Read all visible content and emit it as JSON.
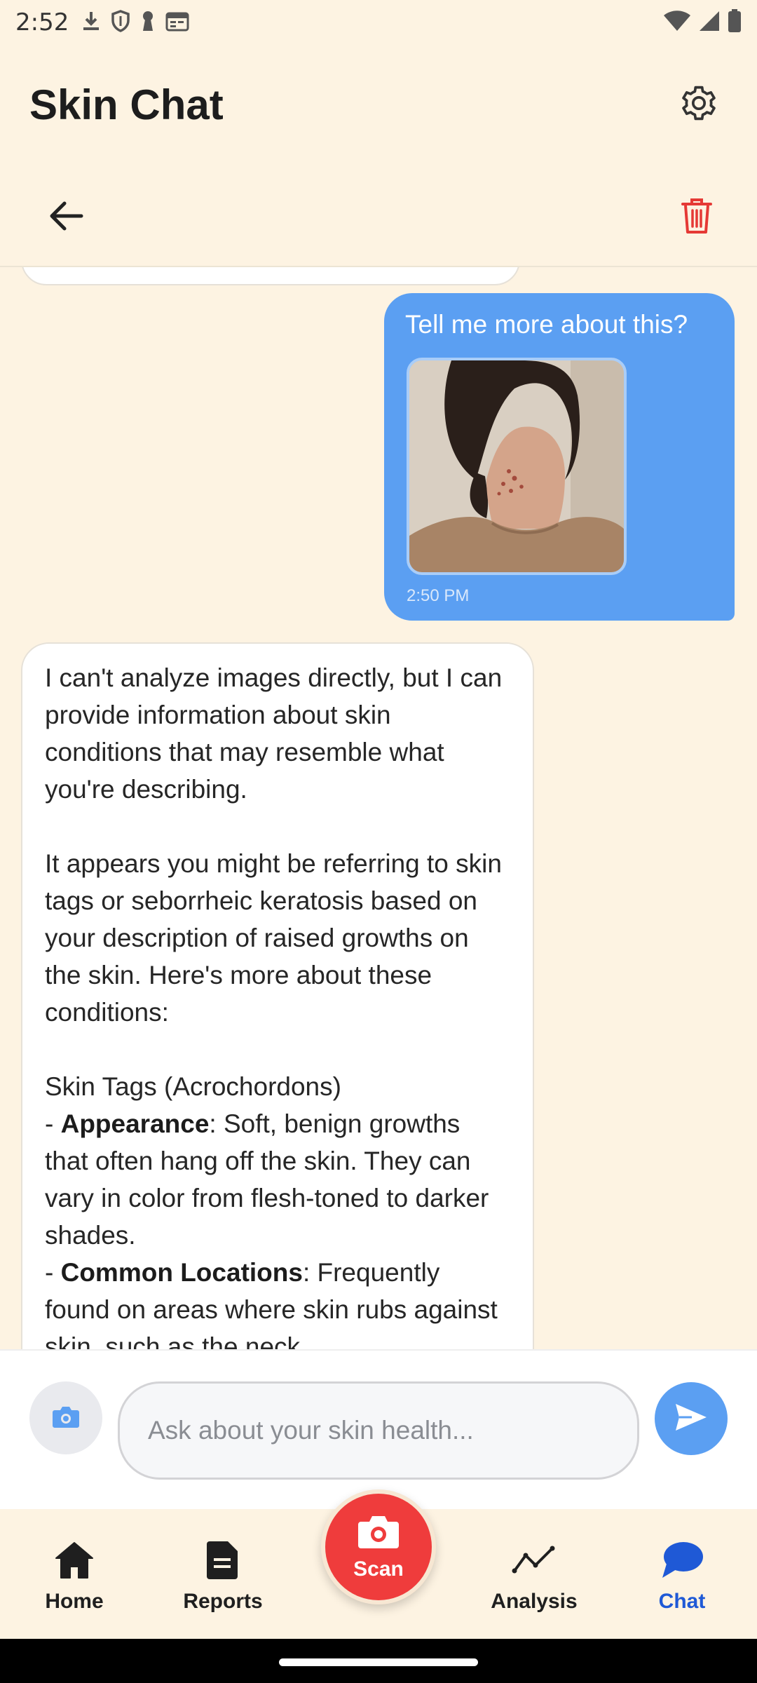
{
  "status_bar": {
    "time": "2:52",
    "left_icons": [
      "download-icon",
      "shield-icon",
      "keyhole-icon",
      "calendar-icon"
    ],
    "right_icons": [
      "wifi-icon",
      "signal-icon",
      "battery-icon"
    ]
  },
  "header": {
    "title": "Skin Chat",
    "settings_icon": "gear-icon"
  },
  "toolbar": {
    "back_icon": "arrow-left-icon",
    "delete_icon": "trash-icon",
    "delete_color": "#e53935"
  },
  "messages": {
    "user": {
      "text": "Tell me more about this?",
      "time": "2:50 PM",
      "bubble_color": "#5b9ff2"
    },
    "bot": {
      "p1": "I can't analyze images directly, but I can provide information about skin conditions that may resemble what you're describing.",
      "p2": "It appears you might be referring to skin tags or seborrheic keratosis based on your description of raised growths on the skin. Here's more about these conditions:",
      "p3": "Skin Tags (Acrochordons)",
      "item1_label": "Appearance",
      "item1_text": ": Soft, benign growths that often hang off the skin. They can vary in color from flesh-toned to darker shades.",
      "item2_label": "Common Locations",
      "item2_text": ": Frequently found on areas where skin rubs against skin, such as the neck,"
    }
  },
  "input": {
    "placeholder": "Ask about your skin health...",
    "value": "",
    "camera_icon": "camera-icon",
    "send_icon": "send-icon"
  },
  "nav": {
    "home": "Home",
    "reports": "Reports",
    "scan": "Scan",
    "analysis": "Analysis",
    "chat": "Chat",
    "active": "chat",
    "active_color": "#1f59d6",
    "scan_color": "#ef3c3c"
  }
}
